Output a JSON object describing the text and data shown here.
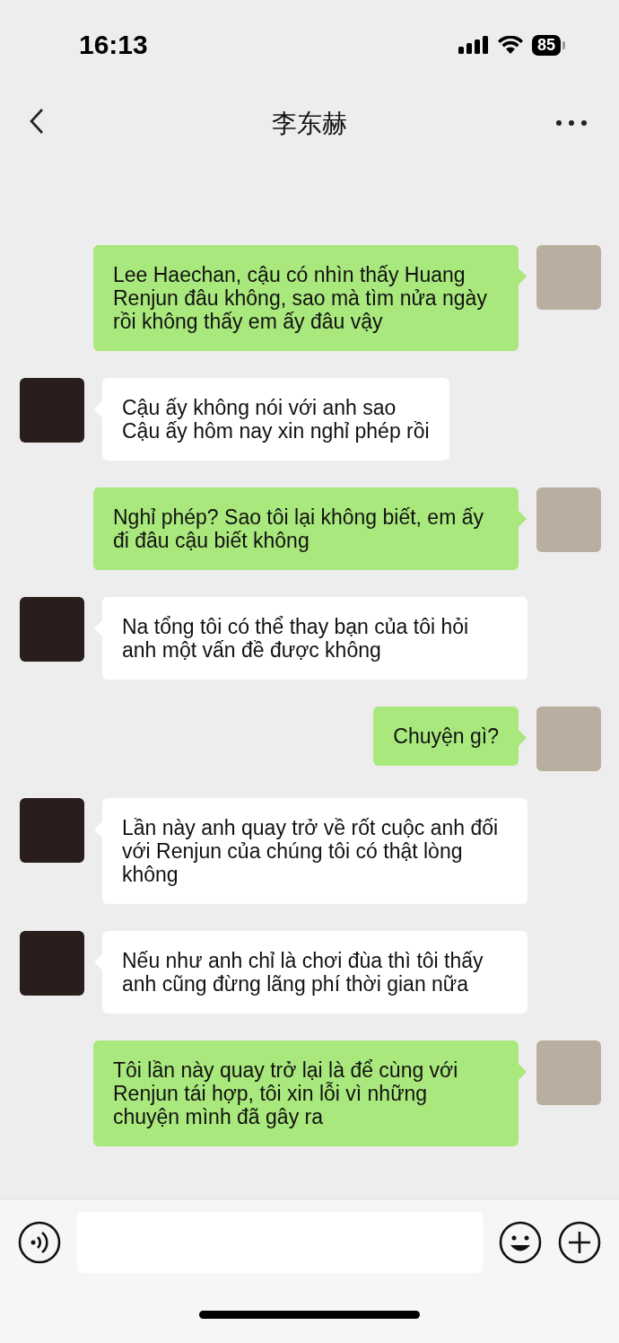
{
  "status_bar": {
    "time": "16:13",
    "battery": "85"
  },
  "header": {
    "title": "李东赫"
  },
  "messages": [
    {
      "kind": "sent",
      "text": "Lee Haechan, cậu có nhìn thấy Huang Renjun đâu không, sao mà tìm nửa ngày rồi không thấy em ấy đâu vậy"
    },
    {
      "kind": "received",
      "text": "Cậu ấy không nói với anh sao\nCậu ấy hôm nay xin nghỉ phép rồi"
    },
    {
      "kind": "sent",
      "text": "Nghỉ phép? Sao tôi lại không biết, em ấy đi đâu cậu biết không"
    },
    {
      "kind": "received",
      "text": "Na tổng tôi có thể thay bạn của tôi hỏi anh một vấn đề được không"
    },
    {
      "kind": "sent",
      "text": "Chuyện gì?"
    },
    {
      "kind": "received",
      "text": "Lần này anh quay trở về rốt cuộc anh đối với Renjun của chúng tôi có thật lòng không"
    },
    {
      "kind": "received",
      "text": "Nếu như anh chỉ là chơi đùa thì tôi thấy anh cũng đừng lãng phí thời gian nữa"
    },
    {
      "kind": "sent",
      "text": "Tôi lần này quay trở lại là để cùng với Renjun tái hợp, tôi xin lỗi vì những chuyện mình đã gây ra"
    }
  ]
}
